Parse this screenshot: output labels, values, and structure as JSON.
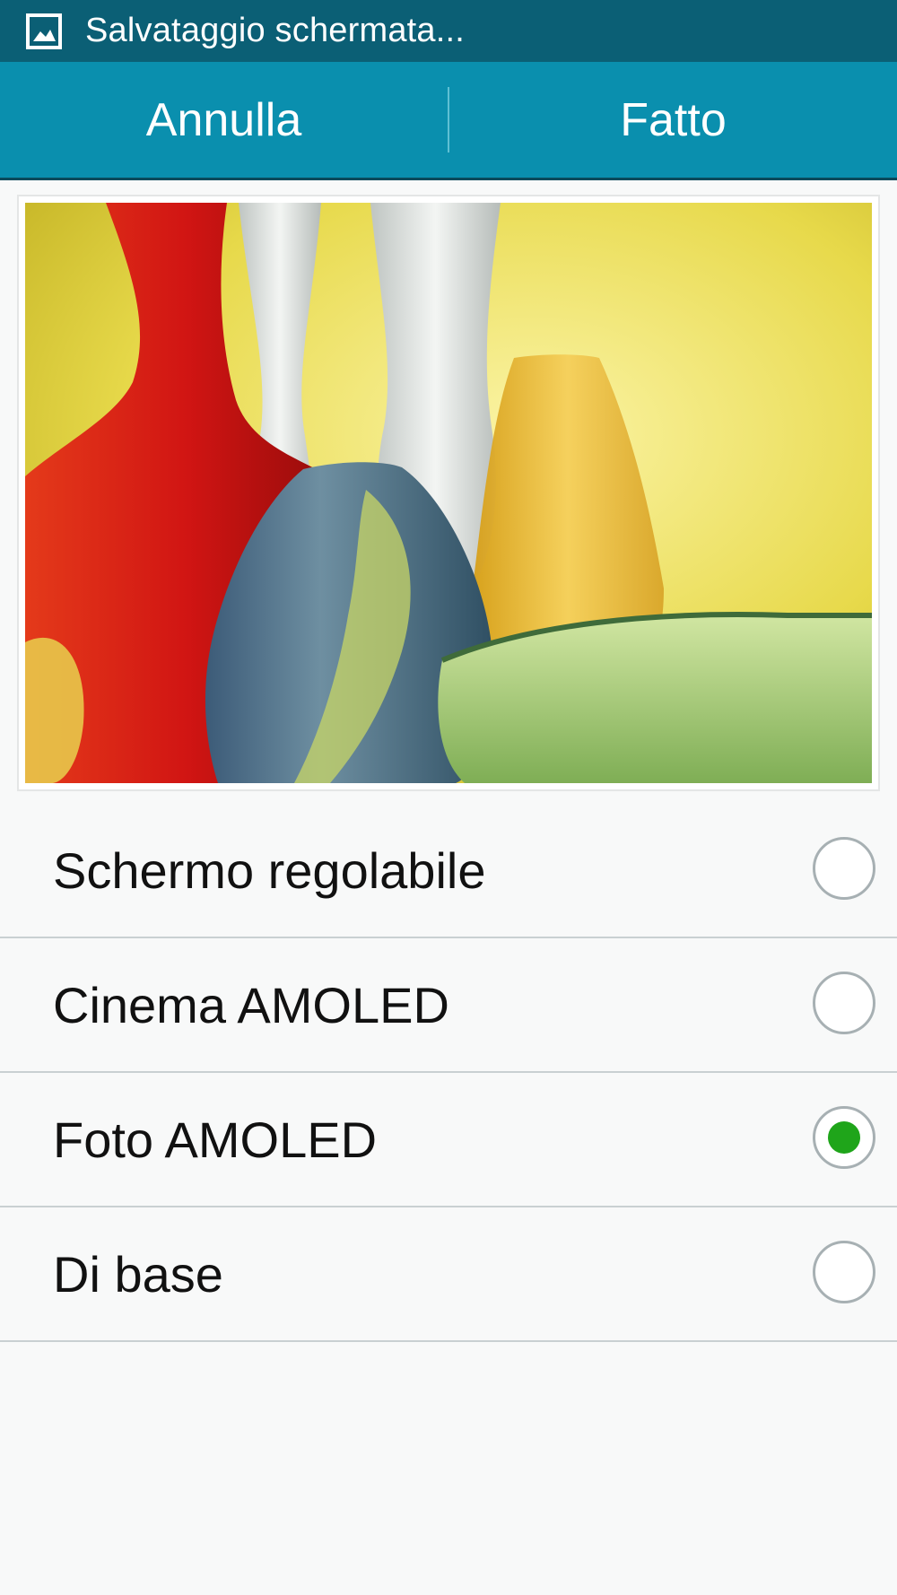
{
  "status_bar": {
    "icon": "image-icon",
    "text": "Salvataggio schermata..."
  },
  "action_bar": {
    "cancel_label": "Annulla",
    "done_label": "Fatto"
  },
  "preview": {
    "icon": "glass-vases-preview-image"
  },
  "options": [
    {
      "label": "Schermo regolabile",
      "selected": false
    },
    {
      "label": "Cinema AMOLED",
      "selected": false
    },
    {
      "label": "Foto AMOLED",
      "selected": true
    },
    {
      "label": "Di base",
      "selected": false
    }
  ],
  "colors": {
    "status_bar": "#0b5f75",
    "action_bar": "#0a8fae",
    "radio_checked": "#1fa51a",
    "background": "#f8f9f9"
  }
}
